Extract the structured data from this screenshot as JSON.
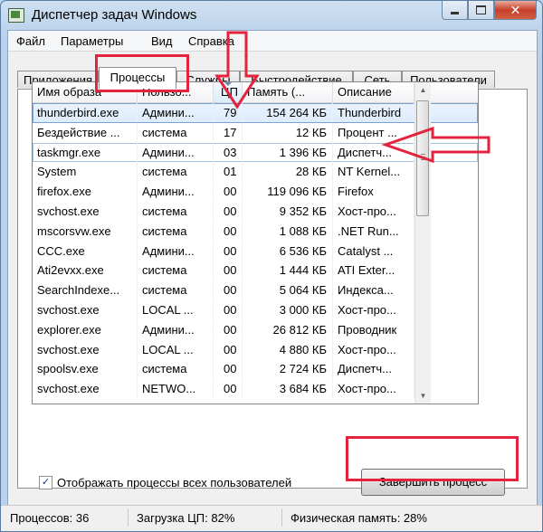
{
  "window": {
    "title": "Диспетчер задач Windows"
  },
  "caption": {
    "close_glyph": "✕"
  },
  "menu": [
    "Файл",
    "Параметры",
    "Вид",
    "Справка"
  ],
  "tabs": [
    "Приложения",
    "Процессы",
    "Службы",
    "Быстродействие",
    "Сеть",
    "Пользователи"
  ],
  "active_tab": "Процессы",
  "table": {
    "columns": [
      "Имя образа",
      "Пользо...",
      "ЦП",
      "Память (...",
      "Описание"
    ],
    "sorted_column": "ЦП",
    "rows": [
      {
        "name": "thunderbird.exe",
        "user": "Админи...",
        "cpu": "79",
        "mem": "154 264 КБ",
        "desc": "Thunderbird"
      },
      {
        "name": "Бездействие ...",
        "user": "система",
        "cpu": "17",
        "mem": "12 КБ",
        "desc": "Процент ..."
      },
      {
        "name": "taskmgr.exe",
        "user": "Админи...",
        "cpu": "03",
        "mem": "1 396 КБ",
        "desc": "Диспетч..."
      },
      {
        "name": "System",
        "user": "система",
        "cpu": "01",
        "mem": "28 КБ",
        "desc": "NT Kernel..."
      },
      {
        "name": "firefox.exe",
        "user": "Админи...",
        "cpu": "00",
        "mem": "119 096 КБ",
        "desc": "Firefox"
      },
      {
        "name": "svchost.exe",
        "user": "система",
        "cpu": "00",
        "mem": "9 352 КБ",
        "desc": "Хост-про..."
      },
      {
        "name": "mscorsvw.exe",
        "user": "система",
        "cpu": "00",
        "mem": "1 088 КБ",
        "desc": ".NET Run..."
      },
      {
        "name": "CCC.exe",
        "user": "Админи...",
        "cpu": "00",
        "mem": "6 536 КБ",
        "desc": "Catalyst ..."
      },
      {
        "name": "Ati2evxx.exe",
        "user": "система",
        "cpu": "00",
        "mem": "1 444 КБ",
        "desc": "ATI Exter..."
      },
      {
        "name": "SearchIndexe...",
        "user": "система",
        "cpu": "00",
        "mem": "5 064 КБ",
        "desc": "Индекса..."
      },
      {
        "name": "svchost.exe",
        "user": "LOCAL ...",
        "cpu": "00",
        "mem": "3 000 КБ",
        "desc": "Хост-про..."
      },
      {
        "name": "explorer.exe",
        "user": "Админи...",
        "cpu": "00",
        "mem": "26 812 КБ",
        "desc": "Проводник"
      },
      {
        "name": "svchost.exe",
        "user": "LOCAL ...",
        "cpu": "00",
        "mem": "4 880 КБ",
        "desc": "Хост-про..."
      },
      {
        "name": "spoolsv.exe",
        "user": "система",
        "cpu": "00",
        "mem": "2 724 КБ",
        "desc": "Диспетч..."
      },
      {
        "name": "svchost.exe",
        "user": "NETWO...",
        "cpu": "00",
        "mem": "3 684 КБ",
        "desc": "Хост-про..."
      }
    ]
  },
  "show_all_users": {
    "label": "Отображать процессы всех пользователей",
    "checked": true,
    "check_glyph": "✓"
  },
  "end_process_button": "Завершить процесс",
  "status": {
    "processes": "Процессов: 36",
    "cpu": "Загрузка ЦП: 82%",
    "memory": "Физическая память: 28%"
  },
  "colors": {
    "annotation_red": "#e5233e",
    "selection_border": "#7da2ce"
  }
}
